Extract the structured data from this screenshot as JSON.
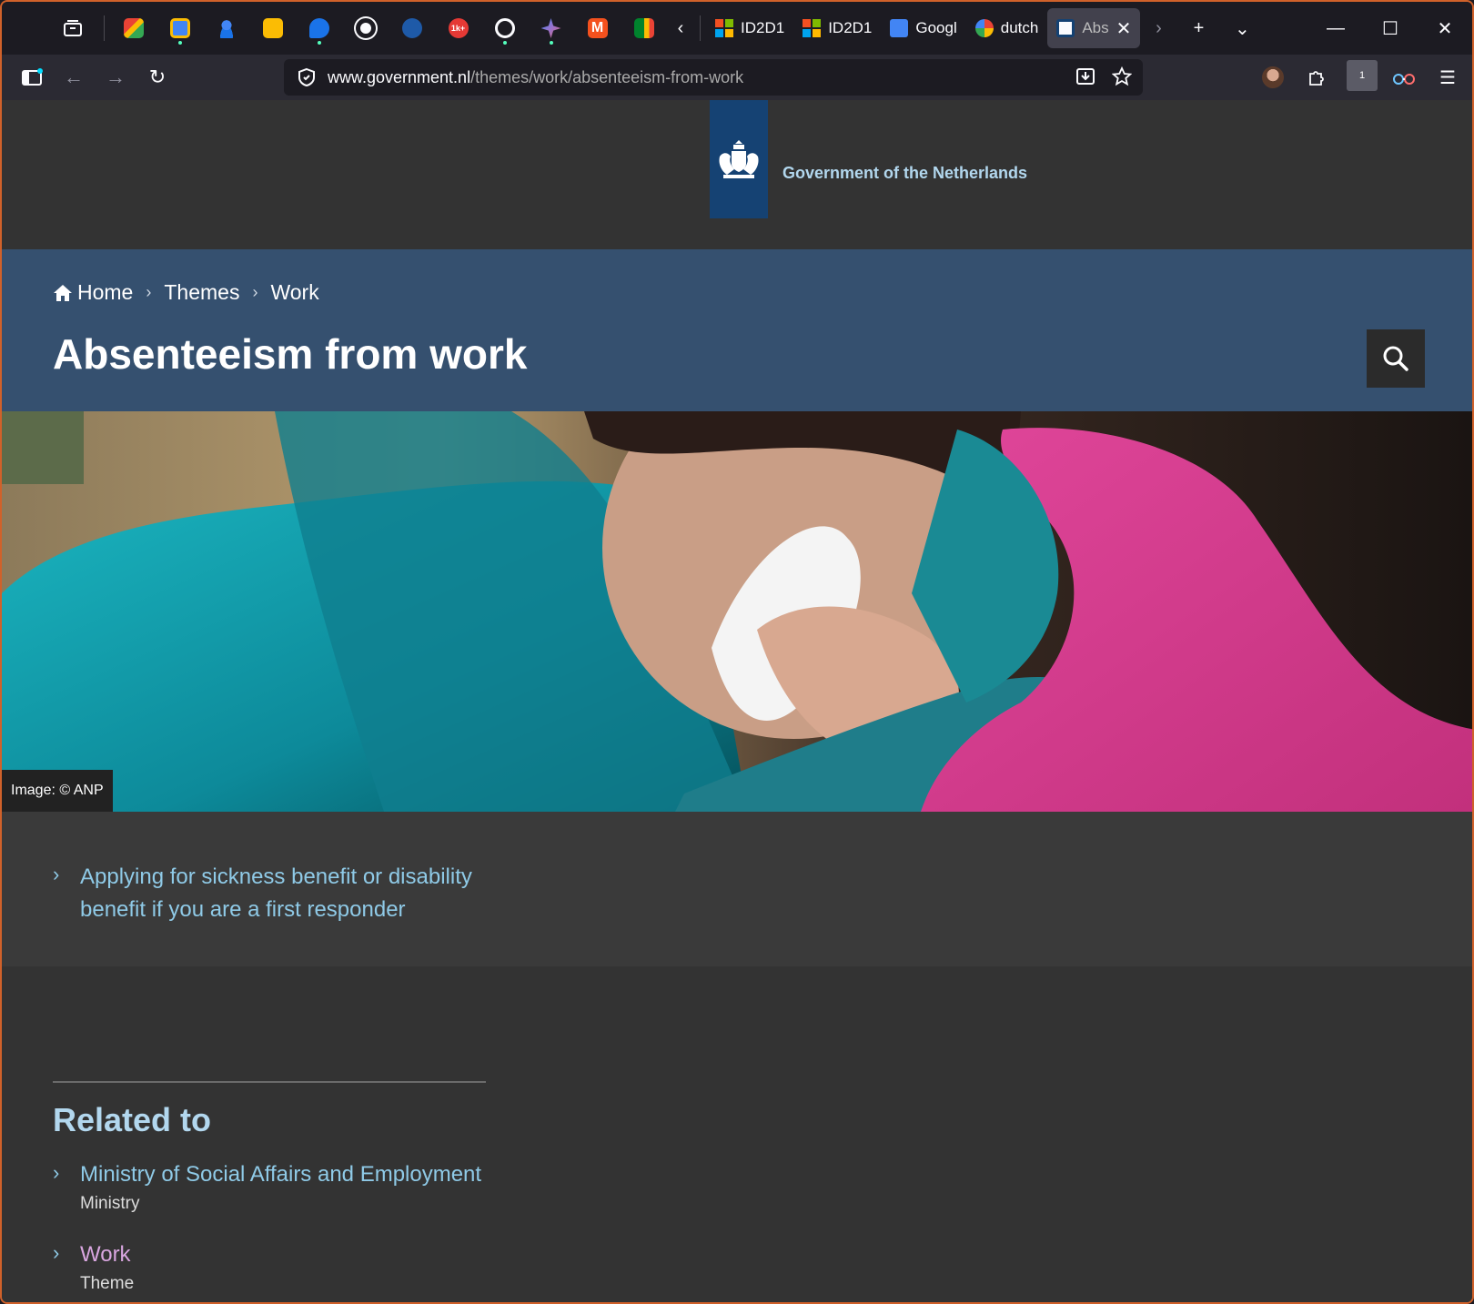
{
  "browser": {
    "tabs": [
      {
        "label": "ID2D1",
        "icon": "microsoft-icon"
      },
      {
        "label": "ID2D1",
        "icon": "microsoft-icon"
      },
      {
        "label": "Googl",
        "icon": "google-translate-icon"
      },
      {
        "label": "dutch",
        "icon": "google-icon"
      },
      {
        "label": "Abs",
        "icon": "government-icon",
        "active": true
      }
    ],
    "pinned_tabs": [
      "gmail-icon",
      "calendar-icon",
      "contacts-icon",
      "keep-icon",
      "chat-icon",
      "github-icon",
      "blue-app-icon",
      "badge-1k-icon",
      "chatgpt-icon",
      "gemini-icon",
      "m-app-icon",
      "meet-icon"
    ],
    "pinned_badge": "1k+",
    "url_domain": "www.government.nl",
    "url_path": "/themes/work/absenteeism-from-work",
    "extension_badge": "1"
  },
  "site": {
    "name": "Government of the Netherlands"
  },
  "breadcrumb": [
    {
      "label": "Home"
    },
    {
      "label": "Themes"
    },
    {
      "label": "Work"
    }
  ],
  "page": {
    "title": "Absenteeism from work",
    "image_credit": "Image: © ANP"
  },
  "links": [
    {
      "line1": "Applying for sickness benefit or disability",
      "line2": "benefit if you are a first responder"
    }
  ],
  "related": {
    "heading": "Related to",
    "items": [
      {
        "label": "Ministry of Social Affairs and Employment",
        "type": "Ministry",
        "visited": false
      },
      {
        "label": "Work",
        "type": "Theme",
        "visited": true
      }
    ]
  },
  "colors": {
    "accent_frame": "#d0612a",
    "rijksoverheid_blue": "#154273",
    "hero_band": "#35506f",
    "link": "#8fcae7",
    "visited_link": "#d9a6e0"
  }
}
